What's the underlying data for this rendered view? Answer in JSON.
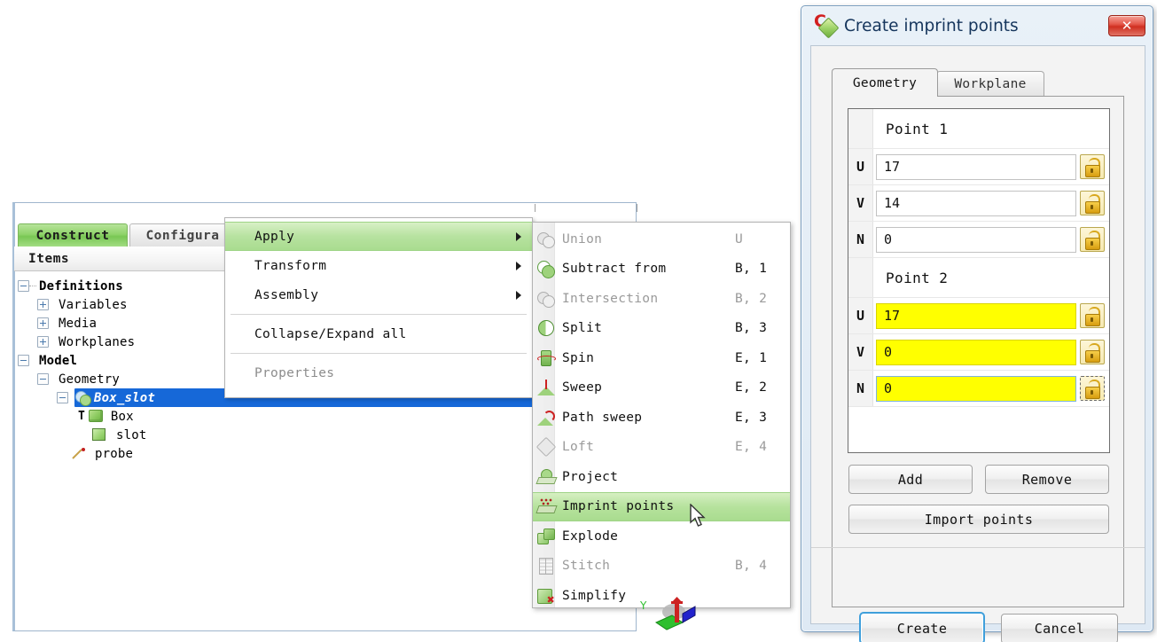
{
  "left_panel": {
    "tabs": [
      {
        "label": "Construct",
        "active": true
      },
      {
        "label": "Configura",
        "active": false
      }
    ],
    "items_header": "Items",
    "tree": [
      {
        "label": "Definitions",
        "icon": "minus-expander-icon",
        "depth": 0,
        "bold": true,
        "expander": "minus",
        "node_icon": "none"
      },
      {
        "label": "Variables",
        "icon": "plus-expander-icon",
        "depth": 1,
        "bold": false,
        "expander": "plus",
        "node_icon": "none"
      },
      {
        "label": "Media",
        "icon": "plus-expander-icon",
        "depth": 1,
        "bold": false,
        "expander": "plus",
        "node_icon": "none"
      },
      {
        "label": "Workplanes",
        "icon": "plus-expander-icon",
        "depth": 1,
        "bold": false,
        "expander": "plus",
        "node_icon": "none"
      },
      {
        "label": "Model",
        "icon": "minus-expander-icon",
        "depth": 0,
        "bold": true,
        "expander": "minus",
        "node_icon": "none"
      },
      {
        "label": "Geometry",
        "icon": "minus-expander-icon",
        "depth": 1,
        "bold": false,
        "expander": "minus",
        "node_icon": "none"
      },
      {
        "label": "Box_slot",
        "icon": "boolean-union-icon",
        "depth": 2,
        "bold": true,
        "expander": "minus",
        "node_icon": "union",
        "selected": true
      },
      {
        "label": "Box",
        "icon": "cube-icon",
        "depth": 3,
        "bold": false,
        "expander": "none",
        "node_icon": "cube",
        "mark": "T"
      },
      {
        "label": "slot",
        "icon": "square-icon",
        "depth": 3,
        "bold": false,
        "expander": "none",
        "node_icon": "square"
      },
      {
        "label": "probe",
        "icon": "probe-line-icon",
        "depth": 2,
        "bold": false,
        "expander": "none",
        "node_icon": "probe"
      }
    ]
  },
  "context_menu": {
    "items": [
      {
        "label": "Apply",
        "submenu": true,
        "highlighted": true,
        "disabled": false
      },
      {
        "label": "Transform",
        "submenu": true,
        "highlighted": false,
        "disabled": false
      },
      {
        "label": "Assembly",
        "submenu": true,
        "highlighted": false,
        "disabled": false
      },
      {
        "separator": true
      },
      {
        "label": "Collapse/Expand all",
        "submenu": false,
        "highlighted": false,
        "disabled": false
      },
      {
        "separator": true
      },
      {
        "label": "Properties",
        "submenu": false,
        "highlighted": false,
        "disabled": true
      }
    ]
  },
  "submenu": {
    "items": [
      {
        "label": "Union",
        "shortcut": "U",
        "icon": "union-icon",
        "disabled": true,
        "highlighted": false
      },
      {
        "label": "Subtract from",
        "shortcut": "B, 1",
        "icon": "subtract-icon",
        "disabled": false,
        "highlighted": false
      },
      {
        "label": "Intersection",
        "shortcut": "B, 2",
        "icon": "intersection-icon",
        "disabled": true,
        "highlighted": false
      },
      {
        "label": "Split",
        "shortcut": "B, 3",
        "icon": "split-icon",
        "disabled": false,
        "highlighted": false
      },
      {
        "label": "Spin",
        "shortcut": "E, 1",
        "icon": "spin-icon",
        "disabled": false,
        "highlighted": false
      },
      {
        "label": "Sweep",
        "shortcut": "E, 2",
        "icon": "sweep-icon",
        "disabled": false,
        "highlighted": false
      },
      {
        "label": "Path sweep",
        "shortcut": "E, 3",
        "icon": "path-sweep-icon",
        "disabled": false,
        "highlighted": false
      },
      {
        "label": "Loft",
        "shortcut": "E, 4",
        "icon": "loft-icon",
        "disabled": true,
        "highlighted": false
      },
      {
        "label": "Project",
        "shortcut": "",
        "icon": "project-icon",
        "disabled": false,
        "highlighted": false
      },
      {
        "label": "Imprint points",
        "shortcut": "",
        "icon": "imprint-points-icon",
        "disabled": false,
        "highlighted": true
      },
      {
        "label": "Explode",
        "shortcut": "",
        "icon": "explode-icon",
        "disabled": false,
        "highlighted": false
      },
      {
        "label": "Stitch",
        "shortcut": "B, 4",
        "icon": "stitch-icon",
        "disabled": true,
        "highlighted": false
      },
      {
        "label": "Simplify",
        "shortcut": "",
        "icon": "simplify-icon",
        "disabled": false,
        "highlighted": false
      }
    ]
  },
  "viewport": {
    "axis_label_y": "Y"
  },
  "dialog": {
    "title": "Create imprint points",
    "close_label": "✕",
    "tabs": [
      {
        "label": "Geometry",
        "active": true
      },
      {
        "label": "Workplane",
        "active": false
      }
    ],
    "points": [
      {
        "header": "Point 1",
        "rows": [
          {
            "label": "U",
            "value": "17",
            "highlighted": false,
            "lock_icon": "unlocked-icon",
            "focused": false
          },
          {
            "label": "V",
            "value": "14",
            "highlighted": false,
            "lock_icon": "unlocked-icon",
            "focused": false
          },
          {
            "label": "N",
            "value": "0",
            "highlighted": false,
            "lock_icon": "unlocked-icon",
            "focused": false
          }
        ]
      },
      {
        "header": "Point 2",
        "rows": [
          {
            "label": "U",
            "value": "17",
            "highlighted": true,
            "lock_icon": "unlocked-icon",
            "focused": false
          },
          {
            "label": "V",
            "value": "0",
            "highlighted": true,
            "lock_icon": "unlocked-icon",
            "focused": false
          },
          {
            "label": "N",
            "value": "0",
            "highlighted": true,
            "lock_icon": "unlocked-icon",
            "focused": true
          }
        ]
      }
    ],
    "buttons": {
      "add": "Add",
      "remove": "Remove",
      "import_points": "Import points",
      "create": "Create",
      "cancel": "Cancel"
    }
  },
  "colors": {
    "accent_green": "#8fd36a",
    "selection_blue": "#1668d8",
    "highlight_yellow": "#ffff00",
    "focus_blue": "#3f9fdb",
    "close_red": "#cf2f20"
  }
}
